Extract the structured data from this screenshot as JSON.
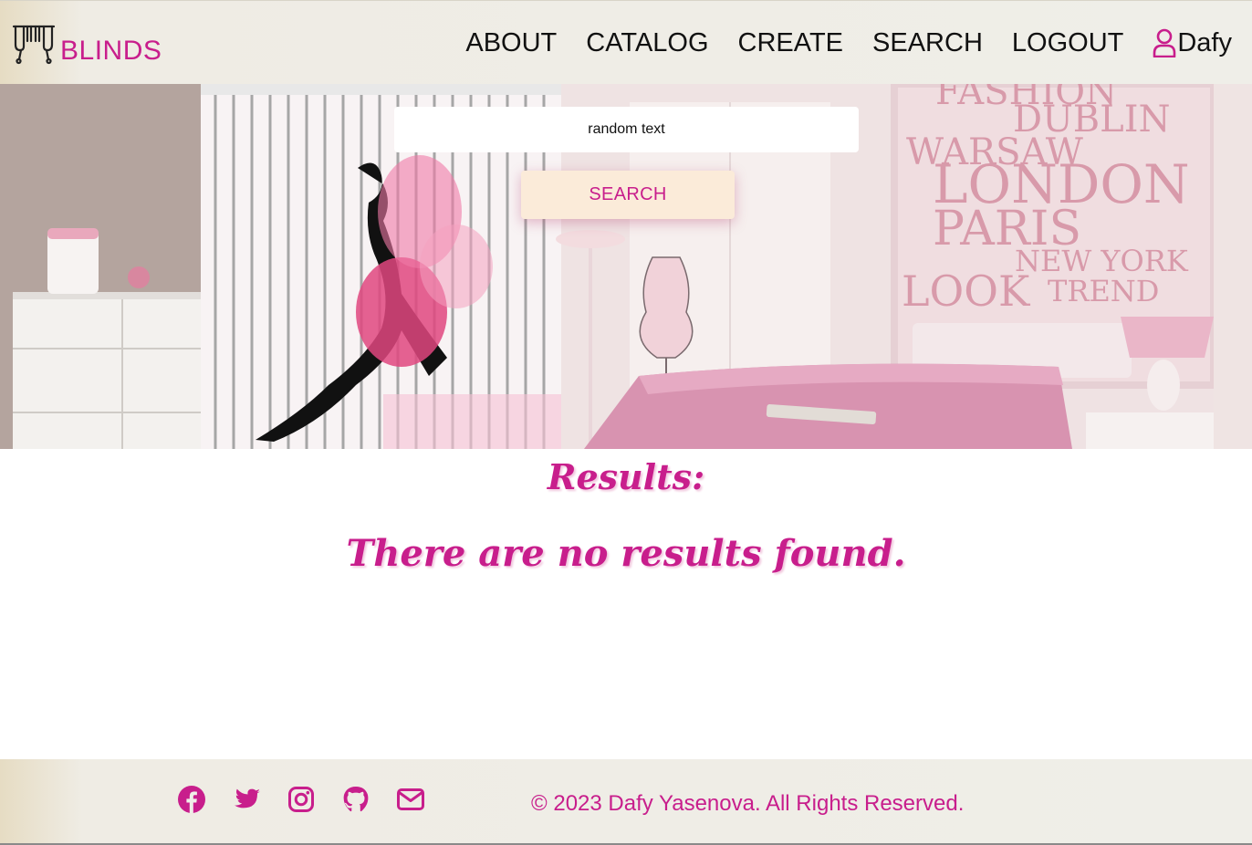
{
  "header": {
    "brand": "BLINDS",
    "nav": {
      "about": "ABOUT",
      "catalog": "CATALOG",
      "create": "CREATE",
      "search": "SEARCH",
      "logout": "LOGOUT",
      "user": "Dafy"
    }
  },
  "hero": {
    "search_value": "random text",
    "search_button": "SEARCH",
    "wall_words": [
      "FASHION",
      "DUBLIN",
      "WARSAW",
      "LONDON",
      "PARIS",
      "NEW YORK",
      "LOOK",
      "TREND"
    ]
  },
  "results": {
    "title": "Results:",
    "empty_message": "There are no results found."
  },
  "footer": {
    "icons": [
      "facebook-icon",
      "twitter-icon",
      "instagram-icon",
      "github-icon",
      "mail-icon"
    ],
    "copyright": "© 2023 Dafy Yasenova. All Rights Reserved."
  },
  "colors": {
    "accent": "#c81e8c",
    "header_bg": "#efeee8",
    "button_bg": "#fbebd9"
  }
}
